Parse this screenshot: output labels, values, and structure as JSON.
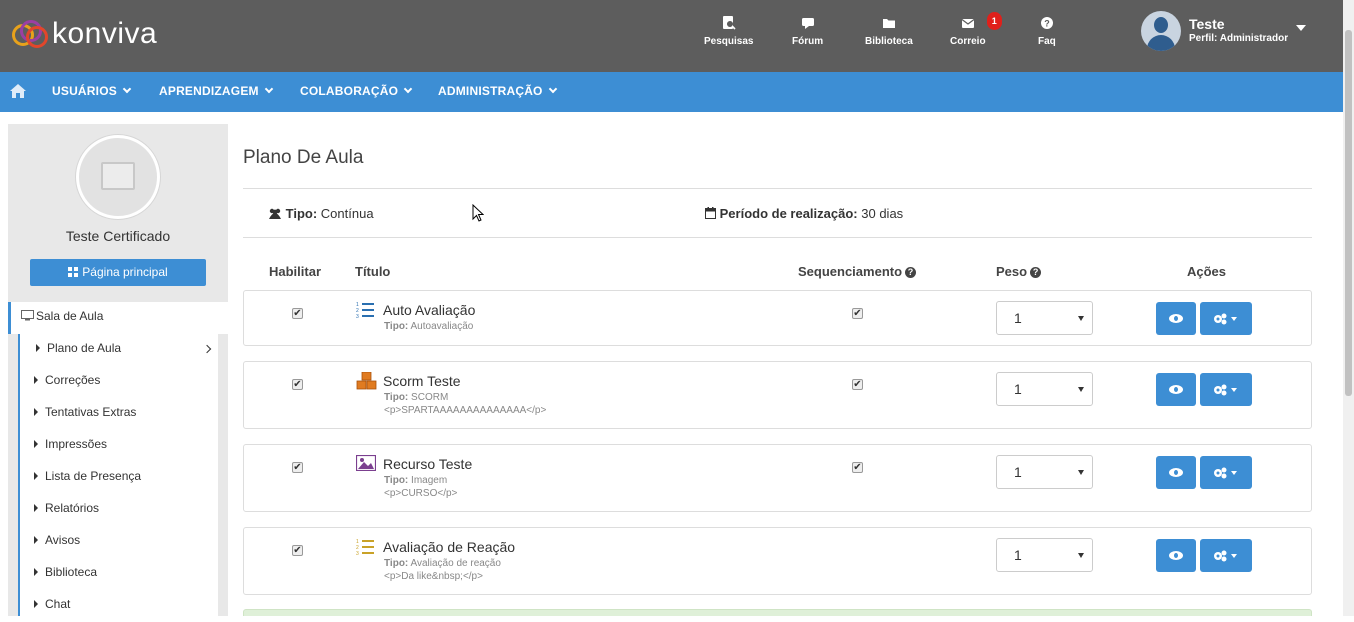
{
  "brand": {
    "name": "konviva"
  },
  "topnav": [
    {
      "label": "Pesquisas",
      "icon": "search-doc-icon"
    },
    {
      "label": "Fórum",
      "icon": "chat-bubble-icon"
    },
    {
      "label": "Biblioteca",
      "icon": "folder-icon"
    },
    {
      "label": "Correio",
      "icon": "envelope-icon",
      "badge": "1"
    },
    {
      "label": "Faq",
      "icon": "question-circle-icon"
    }
  ],
  "user": {
    "name": "Teste",
    "profile": "Perfil: Administrador"
  },
  "menu": [
    {
      "label": "USUÁRIOS"
    },
    {
      "label": "APRENDIZAGEM"
    },
    {
      "label": "COLABORAÇÃO"
    },
    {
      "label": "ADMINISTRAÇÃO"
    }
  ],
  "sidebar": {
    "course_name": "Teste Certificado",
    "main_button": "Página principal",
    "section": "Sala de Aula",
    "items": [
      {
        "label": "Plano de Aula"
      },
      {
        "label": "Correções"
      },
      {
        "label": "Tentativas Extras"
      },
      {
        "label": "Impressões"
      },
      {
        "label": "Lista de Presença"
      },
      {
        "label": "Relatórios"
      },
      {
        "label": "Avisos"
      },
      {
        "label": "Biblioteca"
      },
      {
        "label": "Chat"
      }
    ]
  },
  "content": {
    "title": "Plano De Aula",
    "tipo_label": "Tipo:",
    "tipo_value": "Contínua",
    "periodo_label": "Período de realização:",
    "periodo_value": "30 dias",
    "columns": {
      "habilitar": "Habilitar",
      "titulo": "Título",
      "sequenciamento": "Sequenciamento",
      "peso": "Peso",
      "acoes": "Ações"
    },
    "rows": [
      {
        "title": "Auto Avaliação",
        "tipo_label": "Tipo:",
        "tipo": "Autoavaliação",
        "desc": "",
        "peso": "1",
        "icon": "numbered-list-icon",
        "icon_color": "#2a6fb0",
        "habilitar": true,
        "sequenciamento": true
      },
      {
        "title": "Scorm Teste",
        "tipo_label": "Tipo:",
        "tipo": "SCORM",
        "desc": "<p>SPARTAAAAAAAAAAAAAA</p>",
        "peso": "1",
        "icon": "cubes-icon",
        "icon_color": "#e07b20",
        "habilitar": true,
        "sequenciamento": true
      },
      {
        "title": "Recurso Teste",
        "tipo_label": "Tipo:",
        "tipo": "Imagem",
        "desc": "<p>CURSO</p>",
        "peso": "1",
        "icon": "image-icon",
        "icon_color": "#7b3f8f",
        "habilitar": true,
        "sequenciamento": true
      },
      {
        "title": "Avaliação de Reação",
        "tipo_label": "Tipo:",
        "tipo": "Avaliação de reação",
        "desc": "<p>Da like&nbsp;</p>",
        "peso": "1",
        "icon": "numbered-list-icon",
        "icon_color": "#c9a227",
        "habilitar": true,
        "sequenciamento": false
      }
    ]
  },
  "colors": {
    "topbar": "#5d5d5d",
    "accent": "#3d8ed4",
    "sidebar": "#e8e8e8",
    "badge": "#e0201b"
  }
}
